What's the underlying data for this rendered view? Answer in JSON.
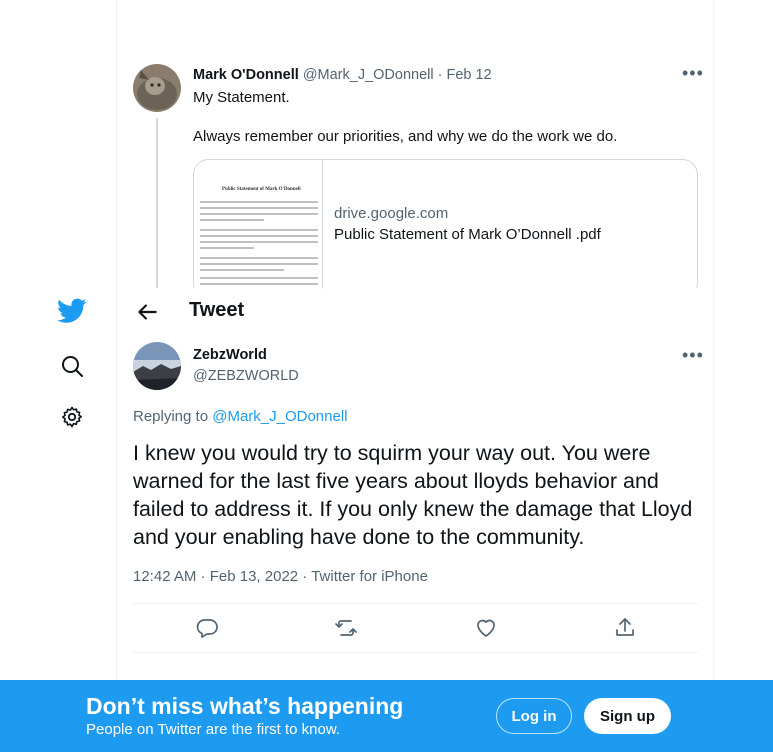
{
  "parent_tweet": {
    "author_name": "Mark O'Donnell",
    "author_handle": "@Mark_J_ODonnell",
    "date_sep": "·",
    "date": "Feb 12",
    "more_label": "•••",
    "text_line1": "My Statement.",
    "text_line2": "Always remember our priorities, and why we do the work we do.",
    "card": {
      "domain": "drive.google.com",
      "title": "Public Statement of Mark O’Donnell .pdf",
      "thumb_heading": "Public Statement of Mark O'Donnell"
    }
  },
  "nav": {
    "logo_icon": "twitter-bird-icon",
    "search_icon": "search-icon",
    "settings_icon": "gear-icon"
  },
  "header": {
    "back_icon": "back-arrow-icon",
    "title": "Tweet"
  },
  "main_tweet": {
    "author_name": "ZebzWorld",
    "author_handle": "@ZEBZWORLD",
    "more_label": "•••",
    "replying_prefix": "Replying to ",
    "replying_to": "@Mark_J_ODonnell",
    "text": "I knew you would try to squirm your way out.  You were warned for the last five years about lloyds behavior and failed to address it.  If you only knew the damage that Lloyd and your enabling have done to the community.",
    "time": "12:42 AM",
    "date": "Feb 13, 2022",
    "source": "Twitter for iPhone",
    "sep": " · ",
    "actions": [
      "reply-icon",
      "retweet-icon",
      "like-icon",
      "share-icon"
    ]
  },
  "bottom_bar": {
    "title": "Don’t miss what’s happening",
    "subtitle": "People on Twitter are the first to know.",
    "login_label": "Log in",
    "signup_label": "Sign up"
  },
  "colors": {
    "accent": "#1d9bf0",
    "text": "#0f1419",
    "secondary": "#536471",
    "border": "#cfd9de"
  }
}
